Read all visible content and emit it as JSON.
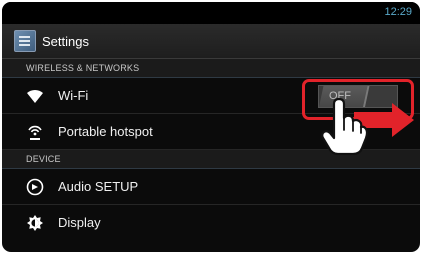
{
  "status_bar": {
    "time": "12:29"
  },
  "action_bar": {
    "title": "Settings",
    "icon": "settings-app-icon"
  },
  "sections": [
    {
      "header": "WIRELESS & NETWORKS",
      "items": [
        {
          "label": "Wi-Fi",
          "icon": "wifi-icon",
          "toggle_state": "OFF"
        },
        {
          "label": "Portable hotspot",
          "icon": "hotspot-icon"
        }
      ]
    },
    {
      "header": "DEVICE",
      "items": [
        {
          "label": "Audio SETUP",
          "icon": "audio-icon"
        },
        {
          "label": "Display",
          "icon": "display-icon"
        }
      ]
    }
  ],
  "annotation": {
    "highlight_color": "#e2232a",
    "gesture": "swipe-right-hand-icon"
  },
  "colors": {
    "background": "#0b0b0b",
    "clock": "#5aa9c9"
  }
}
